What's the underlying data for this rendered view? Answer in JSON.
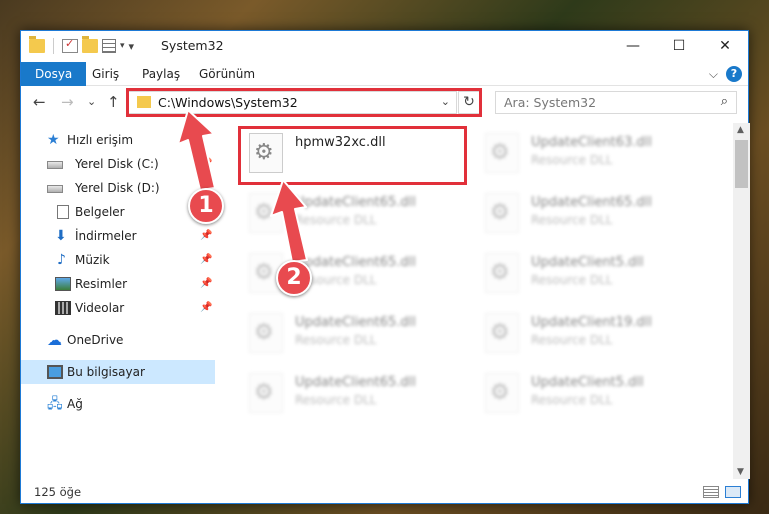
{
  "window": {
    "title": "System32",
    "buttons": {
      "minimize": "—",
      "maximize": "☐",
      "close": "✕"
    }
  },
  "ribbon": {
    "tabs": [
      "Dosya",
      "Giriş",
      "Paylaş",
      "Görünüm"
    ],
    "active_tab": "Dosya",
    "help": "?",
    "expand": "⌵"
  },
  "nav": {
    "back": "←",
    "forward": "→",
    "recent": "⌄",
    "up": "↑",
    "address": "C:\\Windows\\System32",
    "address_dropdown": "⌄",
    "refresh": "↻",
    "search_placeholder": "Ara: System32",
    "search_icon": "⌕"
  },
  "sidebar": {
    "items": [
      {
        "label": "Hızlı erişim",
        "icon": "star-icon"
      },
      {
        "label": "Yerel Disk (C:)",
        "icon": "disk-icon",
        "pinned": true
      },
      {
        "label": "Yerel Disk (D:)",
        "icon": "disk-icon",
        "pinned": true
      },
      {
        "label": "Belgeler",
        "icon": "document-icon",
        "pinned": true
      },
      {
        "label": "İndirmeler",
        "icon": "download-icon",
        "pinned": true
      },
      {
        "label": "Müzik",
        "icon": "music-icon",
        "pinned": true
      },
      {
        "label": "Resimler",
        "icon": "pictures-icon",
        "pinned": true
      },
      {
        "label": "Videolar",
        "icon": "videos-icon",
        "pinned": true
      },
      {
        "label": "OneDrive",
        "icon": "cloud-icon"
      },
      {
        "label": "Bu bilgisayar",
        "icon": "computer-icon",
        "selected": true
      },
      {
        "label": "Ağ",
        "icon": "network-icon"
      }
    ],
    "pin_glyph": "📌"
  },
  "files": [
    {
      "name": "hpmw32xc.dll",
      "type": ""
    },
    {
      "name": "UpdateClient63.dll",
      "type": "Resource DLL"
    },
    {
      "name": "UpdateClient65.dll",
      "type": "Resource DLL"
    },
    {
      "name": "UpdateClient65.dll",
      "type": "Resource DLL"
    },
    {
      "name": "UpdateClient65.dll",
      "type": "Resource DLL"
    },
    {
      "name": "UpdateClient5.dll",
      "type": "Resource DLL"
    },
    {
      "name": "UpdateClient65.dll",
      "type": "Resource DLL"
    },
    {
      "name": "UpdateClient19.dll",
      "type": "Resource DLL"
    },
    {
      "name": "UpdateClient65.dll",
      "type": "Resource DLL"
    },
    {
      "name": "UpdateClient5.dll",
      "type": "Resource DLL"
    }
  ],
  "status": {
    "count": "125 öğe"
  },
  "annotations": {
    "step1": "1",
    "step2": "2",
    "accent_color": "#e1303a"
  }
}
